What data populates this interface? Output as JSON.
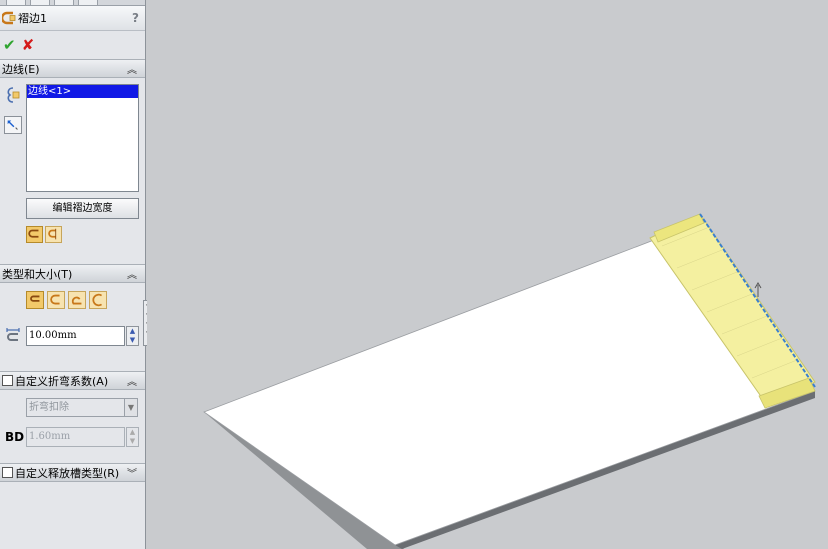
{
  "feature": {
    "title": "褶边1",
    "help": "?"
  },
  "actions": {
    "ok": "✔",
    "cancel": "✘"
  },
  "edges_section": {
    "header": "边线(E)",
    "list_items": [
      "边线<1>"
    ],
    "edit_button": "编辑褶边宽度"
  },
  "type_section": {
    "header": "类型和大小(T)",
    "length_value": "10.00mm"
  },
  "bend_section": {
    "header": "自定义折弯系数(A)",
    "select_value": "折弯扣除",
    "bd_label": "BD",
    "bd_value": "1.60mm"
  },
  "relief_section": {
    "header": "自定义释放槽类型(R)"
  },
  "colors": {
    "panel_bg": "#e4e6ea",
    "viewport_bg": "#c9cbce",
    "selection_blue": "#1119e6",
    "preview_yellow": "#f4f0a0",
    "edge_highlight": "#3a7fd0"
  },
  "icons": {
    "feature": "hem-icon",
    "ok": "checkmark-icon",
    "cancel": "x-icon",
    "edge_select": "edge-select-icon",
    "flip": "reverse-direction-icon",
    "length": "hem-length-icon"
  }
}
